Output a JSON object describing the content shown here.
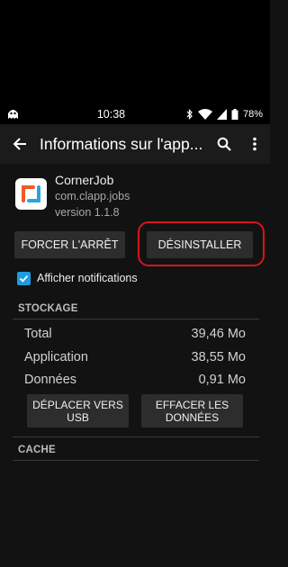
{
  "status_bar": {
    "time": "10:38",
    "battery": "78%",
    "icons": [
      "ghost-icon",
      "bluetooth-icon",
      "wifi-icon",
      "signal-icon",
      "battery-icon"
    ]
  },
  "toolbar": {
    "title": "Informations sur l'app...",
    "back_icon": "arrow-back-icon",
    "search_icon": "search-icon",
    "menu_icon": "more-vert-icon"
  },
  "app": {
    "name": "CornerJob",
    "package": "com.clapp.jobs",
    "version": "version 1.1.8"
  },
  "buttons": {
    "force_stop": "FORCER L'ARRÊT",
    "uninstall": "DÉSINSTALLER",
    "move_usb": "DÉPLACER VERS USB",
    "clear_data": "EFFACER LES DONNÉES"
  },
  "notifications": {
    "label": "Afficher notifications",
    "checked": true
  },
  "storage": {
    "header": "STOCKAGE",
    "rows": [
      {
        "label": "Total",
        "value": "39,46 Mo"
      },
      {
        "label": "Application",
        "value": "38,55 Mo"
      },
      {
        "label": "Données",
        "value": "0,91 Mo"
      }
    ]
  },
  "cache": {
    "header": "CACHE"
  },
  "colors": {
    "accent": "#1c9ce0",
    "highlight": "#d8141c",
    "background": "#121212"
  }
}
